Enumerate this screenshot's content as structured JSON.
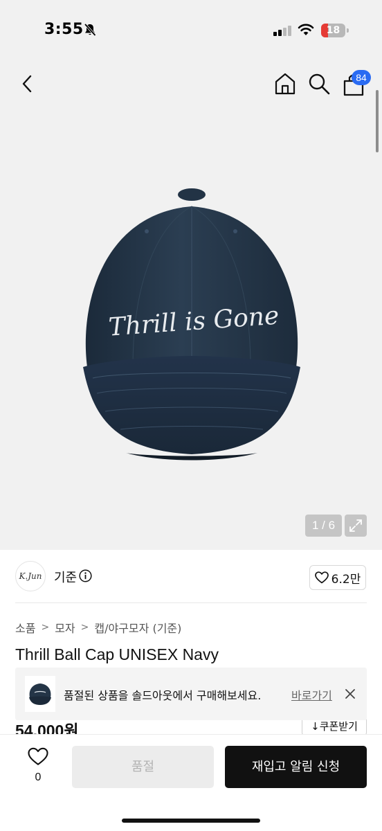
{
  "status_bar": {
    "time": "3:55",
    "battery_level": "18",
    "icons": [
      "bell-slash-icon",
      "signal-icon",
      "wifi-icon",
      "battery-icon"
    ]
  },
  "nav": {
    "icons": [
      "back-icon",
      "home-icon",
      "search-icon",
      "cart-icon"
    ],
    "cart_count": "84"
  },
  "gallery": {
    "cap_embroidery": "Thrill is Gone",
    "counter": "1 / 6",
    "expand_icon": "expand-icon"
  },
  "brand": {
    "logo_text": "K.Jun",
    "name": "기준",
    "like_count": "6.2만"
  },
  "breadcrumb": [
    "소품",
    "모자",
    "캡/야구모자 (기준)"
  ],
  "product": {
    "title": "Thrill Ball Cap UNISEX Navy",
    "price": "54,000원",
    "coupon_label": "쿠폰받기"
  },
  "toast": {
    "message": "품절된 상품을 솔드아웃에서 구매해보세요.",
    "link": "바로가기"
  },
  "bottom": {
    "wish_count": "0",
    "soldout_label": "품절",
    "restock_label": "재입고 알림 신청"
  },
  "colors": {
    "accent_badge": "#2a6bf2",
    "cap_navy": "#243547",
    "primary_button": "#111111",
    "battery_low": "#e53b35"
  }
}
